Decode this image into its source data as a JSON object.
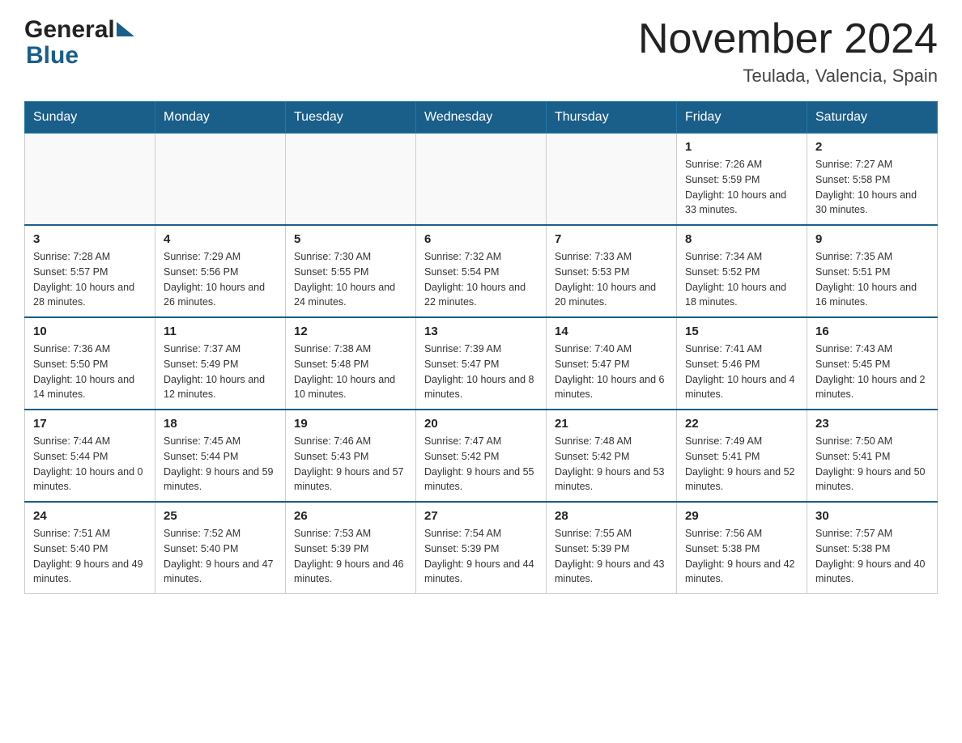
{
  "header": {
    "logo_general": "General",
    "logo_blue": "Blue",
    "month_title": "November 2024",
    "location": "Teulada, Valencia, Spain"
  },
  "weekdays": [
    "Sunday",
    "Monday",
    "Tuesday",
    "Wednesday",
    "Thursday",
    "Friday",
    "Saturday"
  ],
  "weeks": [
    {
      "days": [
        {
          "number": "",
          "info": ""
        },
        {
          "number": "",
          "info": ""
        },
        {
          "number": "",
          "info": ""
        },
        {
          "number": "",
          "info": ""
        },
        {
          "number": "",
          "info": ""
        },
        {
          "number": "1",
          "info": "Sunrise: 7:26 AM\nSunset: 5:59 PM\nDaylight: 10 hours and 33 minutes."
        },
        {
          "number": "2",
          "info": "Sunrise: 7:27 AM\nSunset: 5:58 PM\nDaylight: 10 hours and 30 minutes."
        }
      ]
    },
    {
      "days": [
        {
          "number": "3",
          "info": "Sunrise: 7:28 AM\nSunset: 5:57 PM\nDaylight: 10 hours and 28 minutes."
        },
        {
          "number": "4",
          "info": "Sunrise: 7:29 AM\nSunset: 5:56 PM\nDaylight: 10 hours and 26 minutes."
        },
        {
          "number": "5",
          "info": "Sunrise: 7:30 AM\nSunset: 5:55 PM\nDaylight: 10 hours and 24 minutes."
        },
        {
          "number": "6",
          "info": "Sunrise: 7:32 AM\nSunset: 5:54 PM\nDaylight: 10 hours and 22 minutes."
        },
        {
          "number": "7",
          "info": "Sunrise: 7:33 AM\nSunset: 5:53 PM\nDaylight: 10 hours and 20 minutes."
        },
        {
          "number": "8",
          "info": "Sunrise: 7:34 AM\nSunset: 5:52 PM\nDaylight: 10 hours and 18 minutes."
        },
        {
          "number": "9",
          "info": "Sunrise: 7:35 AM\nSunset: 5:51 PM\nDaylight: 10 hours and 16 minutes."
        }
      ]
    },
    {
      "days": [
        {
          "number": "10",
          "info": "Sunrise: 7:36 AM\nSunset: 5:50 PM\nDaylight: 10 hours and 14 minutes."
        },
        {
          "number": "11",
          "info": "Sunrise: 7:37 AM\nSunset: 5:49 PM\nDaylight: 10 hours and 12 minutes."
        },
        {
          "number": "12",
          "info": "Sunrise: 7:38 AM\nSunset: 5:48 PM\nDaylight: 10 hours and 10 minutes."
        },
        {
          "number": "13",
          "info": "Sunrise: 7:39 AM\nSunset: 5:47 PM\nDaylight: 10 hours and 8 minutes."
        },
        {
          "number": "14",
          "info": "Sunrise: 7:40 AM\nSunset: 5:47 PM\nDaylight: 10 hours and 6 minutes."
        },
        {
          "number": "15",
          "info": "Sunrise: 7:41 AM\nSunset: 5:46 PM\nDaylight: 10 hours and 4 minutes."
        },
        {
          "number": "16",
          "info": "Sunrise: 7:43 AM\nSunset: 5:45 PM\nDaylight: 10 hours and 2 minutes."
        }
      ]
    },
    {
      "days": [
        {
          "number": "17",
          "info": "Sunrise: 7:44 AM\nSunset: 5:44 PM\nDaylight: 10 hours and 0 minutes."
        },
        {
          "number": "18",
          "info": "Sunrise: 7:45 AM\nSunset: 5:44 PM\nDaylight: 9 hours and 59 minutes."
        },
        {
          "number": "19",
          "info": "Sunrise: 7:46 AM\nSunset: 5:43 PM\nDaylight: 9 hours and 57 minutes."
        },
        {
          "number": "20",
          "info": "Sunrise: 7:47 AM\nSunset: 5:42 PM\nDaylight: 9 hours and 55 minutes."
        },
        {
          "number": "21",
          "info": "Sunrise: 7:48 AM\nSunset: 5:42 PM\nDaylight: 9 hours and 53 minutes."
        },
        {
          "number": "22",
          "info": "Sunrise: 7:49 AM\nSunset: 5:41 PM\nDaylight: 9 hours and 52 minutes."
        },
        {
          "number": "23",
          "info": "Sunrise: 7:50 AM\nSunset: 5:41 PM\nDaylight: 9 hours and 50 minutes."
        }
      ]
    },
    {
      "days": [
        {
          "number": "24",
          "info": "Sunrise: 7:51 AM\nSunset: 5:40 PM\nDaylight: 9 hours and 49 minutes."
        },
        {
          "number": "25",
          "info": "Sunrise: 7:52 AM\nSunset: 5:40 PM\nDaylight: 9 hours and 47 minutes."
        },
        {
          "number": "26",
          "info": "Sunrise: 7:53 AM\nSunset: 5:39 PM\nDaylight: 9 hours and 46 minutes."
        },
        {
          "number": "27",
          "info": "Sunrise: 7:54 AM\nSunset: 5:39 PM\nDaylight: 9 hours and 44 minutes."
        },
        {
          "number": "28",
          "info": "Sunrise: 7:55 AM\nSunset: 5:39 PM\nDaylight: 9 hours and 43 minutes."
        },
        {
          "number": "29",
          "info": "Sunrise: 7:56 AM\nSunset: 5:38 PM\nDaylight: 9 hours and 42 minutes."
        },
        {
          "number": "30",
          "info": "Sunrise: 7:57 AM\nSunset: 5:38 PM\nDaylight: 9 hours and 40 minutes."
        }
      ]
    }
  ]
}
